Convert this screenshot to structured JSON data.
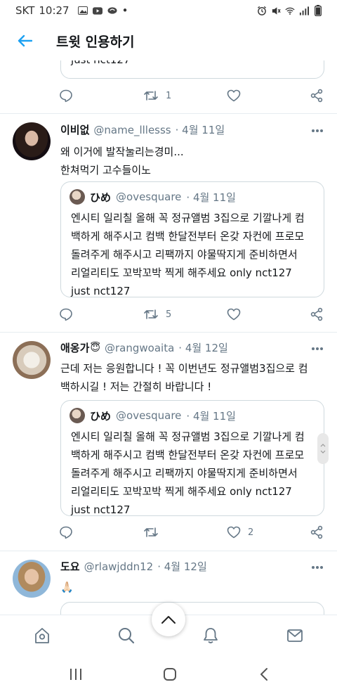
{
  "status_bar": {
    "carrier": "SKT",
    "time": "10:27",
    "dot": "•"
  },
  "header": {
    "title": "트윗 인용하기"
  },
  "top_partial": {
    "quote_tail": "just nct127",
    "retweet_count": "1"
  },
  "tweets": [
    {
      "name": "이비없",
      "badge": "",
      "handle": "@name_lllesss",
      "date": "· 4월 11일",
      "text": "왜 이거에 발작눌리는경미...\n한쳐먹기 고수들이노",
      "quote": {
        "name": "ひめ",
        "handle": "@ovesquare",
        "date": "· 4월 11일",
        "text": "엔시티 일리칠 올해 꼭 정규앨범 3집으로 기깔나게 컴\n백하게 해주시고 컴백 한달전부터 온갖 자컨에 프로모\n돌려주게 해주시고 리팩까지 야물딱지게 준비하면서\n리얼리티도 꼬박꼬박 찍게 해주세요 only nct127\njust nct127"
      },
      "retweet_count": "5",
      "like_count": ""
    },
    {
      "name": "애옹가",
      "badge": "😇",
      "handle": "@rangwoaita",
      "date": "· 4월 12일",
      "text": "근데 저는 응원합니다 !  꼭 이번년도 정규앨범3집으로 컴\n백하시길 ! 저는 간절히 바랍니다 !",
      "quote": {
        "name": "ひめ",
        "handle": "@ovesquare",
        "date": "· 4월 11일",
        "text": "엔시티 일리칠 올해 꼭 정규앨범 3집으로 기깔나게 컴\n백하게 해주시고 컴백 한달전부터 온갖 자컨에 프로모\n돌려주게 해주시고 리팩까지 야물딱지게 준비하면서\n리얼리티도 꼬박꼬박 찍게 해주세요 only nct127\njust nct127"
      },
      "retweet_count": "",
      "like_count": "2"
    },
    {
      "name": "도요",
      "badge": "",
      "handle": "@rlawjddn12",
      "date": "· 4월 12일",
      "text": "🙏🏻"
    }
  ],
  "icons": {
    "reply": "reply-icon",
    "retweet": "retweet-icon",
    "like": "heart-icon",
    "share": "share-icon",
    "more": "more-icon",
    "scroll_top": "chevron-up-icon",
    "tabs": [
      "home-icon",
      "search-icon",
      "bell-icon",
      "mail-icon"
    ],
    "nav": [
      "recent-apps-icon",
      "home-button-icon",
      "back-chevron-icon"
    ]
  },
  "colors": {
    "accent": "#1da1f2",
    "text": "#14171a",
    "muted": "#657786",
    "border": "#cfd9de"
  }
}
